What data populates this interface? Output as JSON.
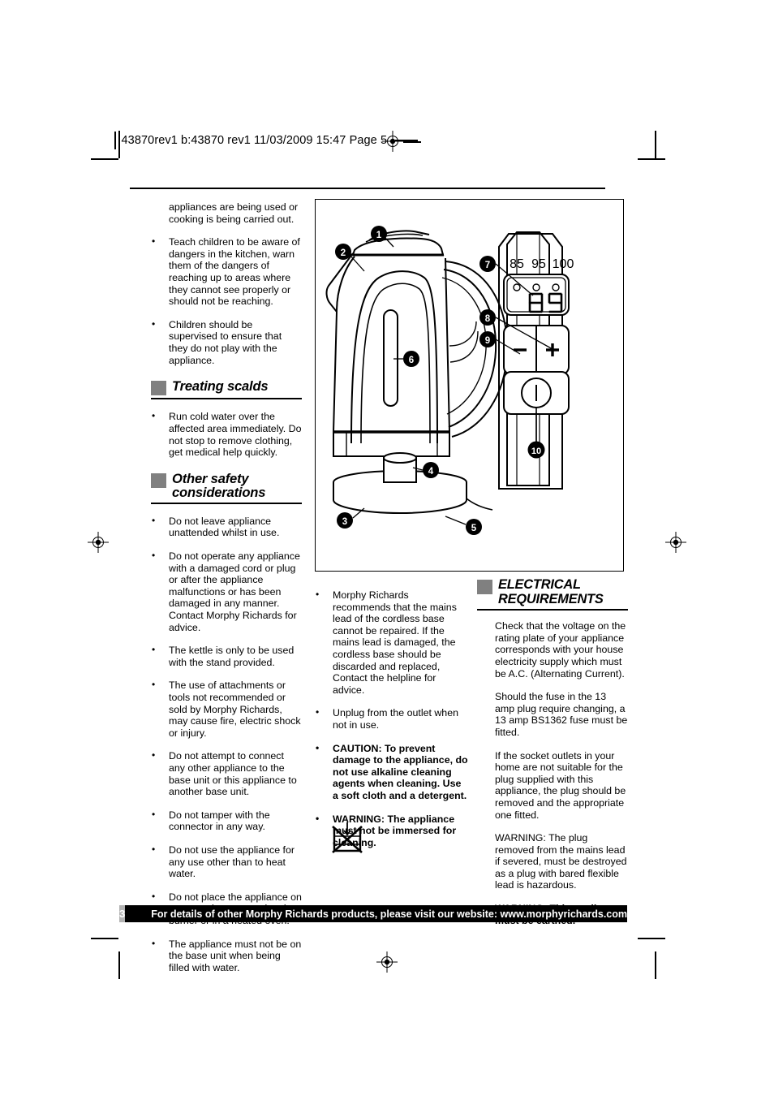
{
  "print_header": {
    "job_info": "43870rev1 b:43870 rev1  11/03/2009  15:47  Page 5"
  },
  "left_column": {
    "lead_paragraph": "appliances are being used or cooking is being carried out.",
    "bullets_top": [
      "Teach children to be aware of dangers in the kitchen, warn them of the dangers of reaching up to areas where they cannot see properly or should not be reaching.",
      "Children should be supervised to ensure that they do not play with the appliance."
    ],
    "section_treating_scalds": {
      "title": "Treating scalds",
      "bullets": [
        "Run cold water over the affected area immediately. Do not stop to remove clothing, get medical help quickly."
      ]
    },
    "section_other_safety": {
      "title": "Other safety considerations",
      "bullets": [
        "Do not leave appliance unattended whilst in use.",
        "Do not operate any appliance with a damaged cord or plug or after the appliance malfunctions or has been damaged in any manner. Contact Morphy Richards for advice.",
        "The kettle is only to be used with the stand provided.",
        "The use of attachments or tools not recommended or sold by Morphy Richards, may cause fire, electric shock or injury.",
        "Do not attempt to connect any other appliance to the base unit or this appliance to another base unit.",
        "Do not tamper with the connector in any way.",
        "Do not use the appliance for any use other than to heat water.",
        "Do not place the appliance on or near a hot gas or electric burner or in a heated oven.",
        "The appliance must not be on the base unit when being filled with water."
      ]
    }
  },
  "middle_column": {
    "bullets": [
      {
        "text": "Morphy Richards recommends that the mains lead of the cordless base cannot be repaired. If the mains lead is damaged, the cordless base should be discarded and replaced, Contact the helpline for advice.",
        "bold": false
      },
      {
        "text": "Unplug from the outlet when not in use.",
        "bold": false
      },
      {
        "text": "CAUTION: To prevent damage to the appliance, do not use alkaline cleaning agents when cleaning. Use a soft cloth and a detergent.",
        "bold": true
      },
      {
        "text": "WARNING: The appliance must not be immersed for cleaning.",
        "bold": true
      }
    ],
    "icon_label": "do-not-immerse-icon"
  },
  "right_column": {
    "section_title": "ELECTRICAL REQUIREMENTS",
    "paragraphs": [
      {
        "text": "Check that the voltage on the rating plate of your appliance corresponds with your house electricity supply which must be A.C. (Alternating Current).",
        "bold": false
      },
      {
        "text": "Should the fuse in the 13 amp plug require changing, a 13 amp BS1362 fuse must be fitted.",
        "bold": false
      },
      {
        "text": "If the socket outlets in your home are not suitable for the plug supplied with this appliance, the plug should be removed and the appropriate one fitted.",
        "bold": false
      },
      {
        "text": "WARNING: The plug removed from the mains lead if severed, must be destroyed as a plug with bared flexible lead is hazardous.",
        "bold": false
      },
      {
        "text": "WARNING: This appliance must be earthed.",
        "bold": true
      }
    ]
  },
  "diagram": {
    "callouts": [
      "1",
      "2",
      "3",
      "4",
      "5",
      "6",
      "7",
      "8",
      "9",
      "10"
    ],
    "control_panel_temperatures": [
      "85",
      "95",
      "100"
    ],
    "display_value": "89",
    "minus_label": "−",
    "plus_label": "+"
  },
  "footer": {
    "page_number": "3",
    "message": "For details of other Morphy Richards products, please visit our website: www.morphyrichards.com"
  },
  "colors": {
    "heading_swatch": "#808080",
    "footer_bar": "#000000",
    "footer_page_box": "#b3b3b3",
    "text": "#000000"
  }
}
